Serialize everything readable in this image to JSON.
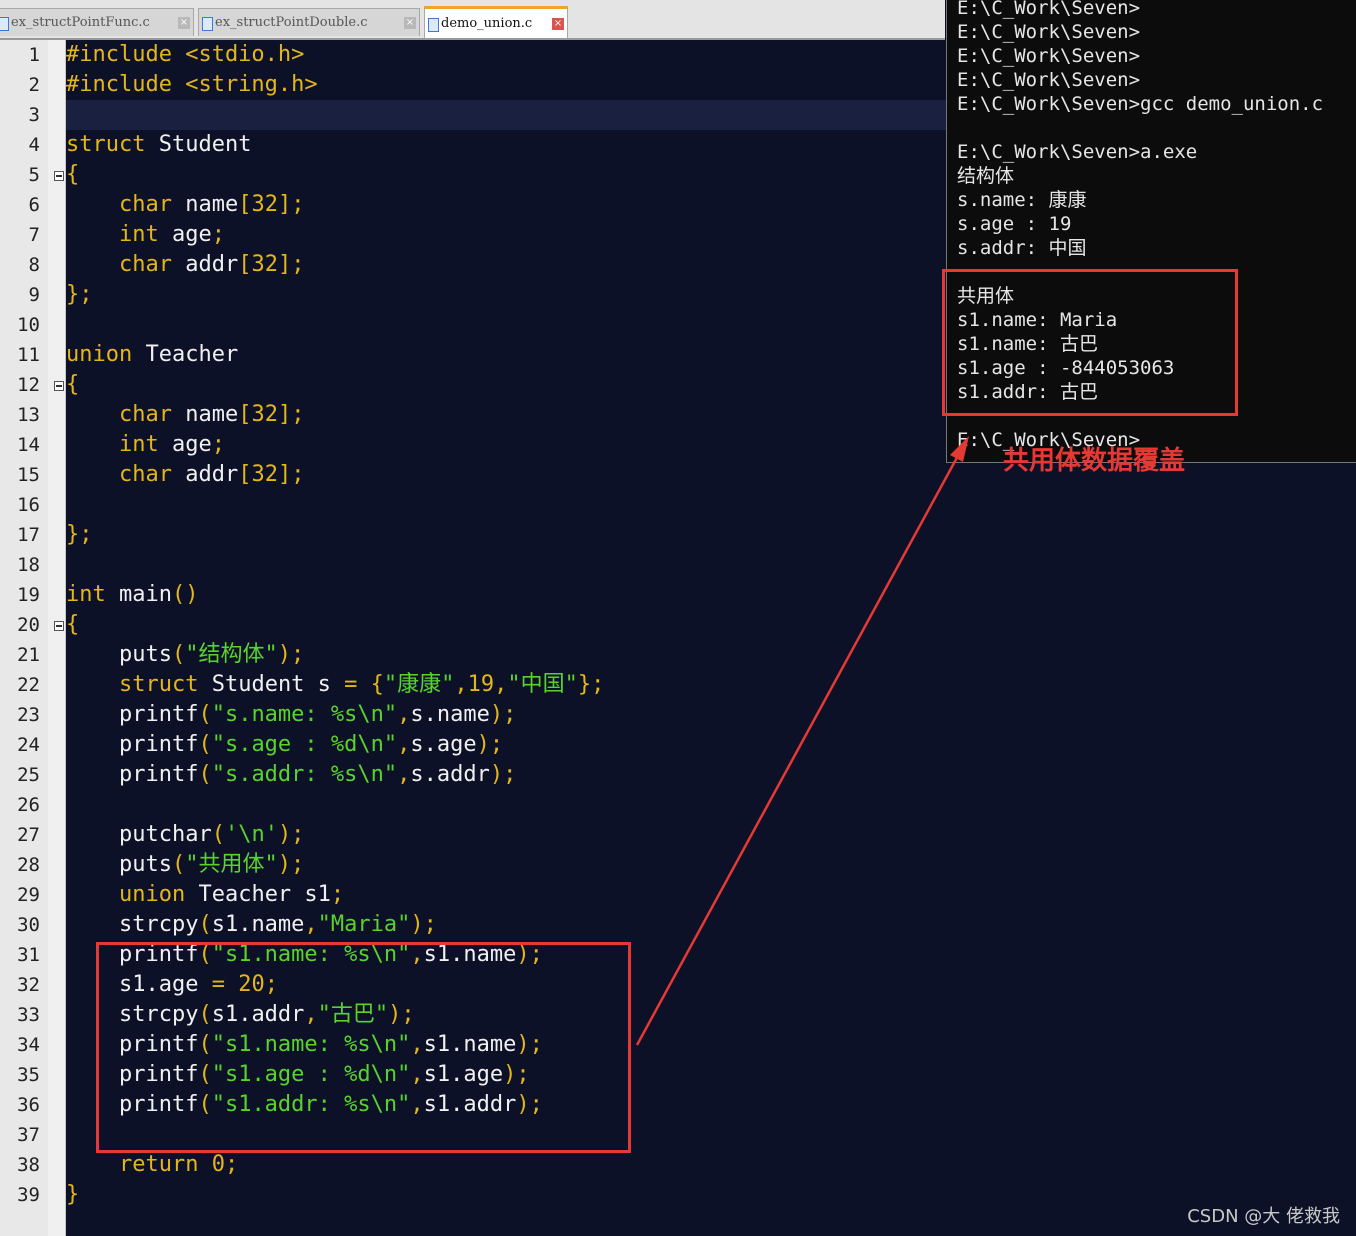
{
  "tabs": [
    {
      "label": "ex_structPointFunc.c",
      "close": "×"
    },
    {
      "label": "ex_structPointDouble.c",
      "close": "×"
    },
    {
      "label": "demo_union.c",
      "close": "×"
    }
  ],
  "code": [
    [
      [
        "pp",
        "#include <stdio.h>"
      ]
    ],
    [
      [
        "pp",
        "#include <string.h>"
      ]
    ],
    [],
    [
      [
        "kw",
        "struct"
      ],
      [
        "pl",
        " Student"
      ]
    ],
    [
      [
        "op",
        "{"
      ]
    ],
    [
      [
        "pl",
        "    "
      ],
      [
        "kw",
        "char"
      ],
      [
        "pl",
        " name"
      ],
      [
        "op",
        "["
      ],
      [
        "num",
        "32"
      ],
      [
        "op",
        "];"
      ]
    ],
    [
      [
        "pl",
        "    "
      ],
      [
        "kw",
        "int"
      ],
      [
        "pl",
        " age"
      ],
      [
        "op",
        ";"
      ]
    ],
    [
      [
        "pl",
        "    "
      ],
      [
        "kw",
        "char"
      ],
      [
        "pl",
        " addr"
      ],
      [
        "op",
        "["
      ],
      [
        "num",
        "32"
      ],
      [
        "op",
        "];"
      ]
    ],
    [
      [
        "op",
        "};"
      ]
    ],
    [],
    [
      [
        "kw",
        "union"
      ],
      [
        "pl",
        " Teacher"
      ]
    ],
    [
      [
        "op",
        "{"
      ]
    ],
    [
      [
        "pl",
        "    "
      ],
      [
        "kw",
        "char"
      ],
      [
        "pl",
        " name"
      ],
      [
        "op",
        "["
      ],
      [
        "num",
        "32"
      ],
      [
        "op",
        "];"
      ]
    ],
    [
      [
        "pl",
        "    "
      ],
      [
        "kw",
        "int"
      ],
      [
        "pl",
        " age"
      ],
      [
        "op",
        ";"
      ]
    ],
    [
      [
        "pl",
        "    "
      ],
      [
        "kw",
        "char"
      ],
      [
        "pl",
        " addr"
      ],
      [
        "op",
        "["
      ],
      [
        "num",
        "32"
      ],
      [
        "op",
        "];"
      ]
    ],
    [],
    [
      [
        "op",
        "};"
      ]
    ],
    [],
    [
      [
        "kw",
        "int"
      ],
      [
        "pl",
        " main"
      ],
      [
        "op",
        "()"
      ]
    ],
    [
      [
        "op",
        "{"
      ]
    ],
    [
      [
        "pl",
        "    puts"
      ],
      [
        "op",
        "("
      ],
      [
        "str",
        "\"结构体\""
      ],
      [
        "op",
        ");"
      ]
    ],
    [
      [
        "pl",
        "    "
      ],
      [
        "kw",
        "struct"
      ],
      [
        "pl",
        " Student s "
      ],
      [
        "op",
        "="
      ],
      [
        "pl",
        " "
      ],
      [
        "op",
        "{"
      ],
      [
        "str",
        "\"康康\""
      ],
      [
        "op",
        ","
      ],
      [
        "num",
        "19"
      ],
      [
        "op",
        ","
      ],
      [
        "str",
        "\"中国\""
      ],
      [
        "op",
        "};"
      ]
    ],
    [
      [
        "pl",
        "    printf"
      ],
      [
        "op",
        "("
      ],
      [
        "str",
        "\"s.name: %s\\n\""
      ],
      [
        "op",
        ","
      ],
      [
        "pl",
        "s.name"
      ],
      [
        "op",
        ");"
      ]
    ],
    [
      [
        "pl",
        "    printf"
      ],
      [
        "op",
        "("
      ],
      [
        "str",
        "\"s.age : %d\\n\""
      ],
      [
        "op",
        ","
      ],
      [
        "pl",
        "s.age"
      ],
      [
        "op",
        ");"
      ]
    ],
    [
      [
        "pl",
        "    printf"
      ],
      [
        "op",
        "("
      ],
      [
        "str",
        "\"s.addr: %s\\n\""
      ],
      [
        "op",
        ","
      ],
      [
        "pl",
        "s.addr"
      ],
      [
        "op",
        ");"
      ]
    ],
    [],
    [
      [
        "pl",
        "    putchar"
      ],
      [
        "op",
        "("
      ],
      [
        "str",
        "'\\n'"
      ],
      [
        "op",
        ");"
      ]
    ],
    [
      [
        "pl",
        "    puts"
      ],
      [
        "op",
        "("
      ],
      [
        "str",
        "\"共用体\""
      ],
      [
        "op",
        ");"
      ]
    ],
    [
      [
        "pl",
        "    "
      ],
      [
        "kw",
        "union"
      ],
      [
        "pl",
        " Teacher s1"
      ],
      [
        "op",
        ";"
      ]
    ],
    [
      [
        "pl",
        "    strcpy"
      ],
      [
        "op",
        "("
      ],
      [
        "pl",
        "s1.name"
      ],
      [
        "op",
        ","
      ],
      [
        "str",
        "\"Maria\""
      ],
      [
        "op",
        ");"
      ]
    ],
    [
      [
        "pl",
        "    printf"
      ],
      [
        "op",
        "("
      ],
      [
        "str",
        "\"s1.name: %s\\n\""
      ],
      [
        "op",
        ","
      ],
      [
        "pl",
        "s1.name"
      ],
      [
        "op",
        ");"
      ]
    ],
    [
      [
        "pl",
        "    s1.age "
      ],
      [
        "op",
        "="
      ],
      [
        "pl",
        " "
      ],
      [
        "num",
        "20"
      ],
      [
        "op",
        ";"
      ]
    ],
    [
      [
        "pl",
        "    strcpy"
      ],
      [
        "op",
        "("
      ],
      [
        "pl",
        "s1.addr"
      ],
      [
        "op",
        ","
      ],
      [
        "str",
        "\"古巴\""
      ],
      [
        "op",
        ");"
      ]
    ],
    [
      [
        "pl",
        "    printf"
      ],
      [
        "op",
        "("
      ],
      [
        "str",
        "\"s1.name: %s\\n\""
      ],
      [
        "op",
        ","
      ],
      [
        "pl",
        "s1.name"
      ],
      [
        "op",
        ");"
      ]
    ],
    [
      [
        "pl",
        "    printf"
      ],
      [
        "op",
        "("
      ],
      [
        "str",
        "\"s1.age : %d\\n\""
      ],
      [
        "op",
        ","
      ],
      [
        "pl",
        "s1.age"
      ],
      [
        "op",
        ");"
      ]
    ],
    [
      [
        "pl",
        "    printf"
      ],
      [
        "op",
        "("
      ],
      [
        "str",
        "\"s1.addr: %s\\n\""
      ],
      [
        "op",
        ","
      ],
      [
        "pl",
        "s1.addr"
      ],
      [
        "op",
        ");"
      ]
    ],
    [],
    [
      [
        "pl",
        "    "
      ],
      [
        "kw",
        "return"
      ],
      [
        "pl",
        " "
      ],
      [
        "num",
        "0"
      ],
      [
        "op",
        ";"
      ]
    ],
    [
      [
        "op",
        "}"
      ]
    ]
  ],
  "fold_lines": [
    5,
    12,
    20
  ],
  "console": {
    "lines": [
      "E:\\C_Work\\Seven>",
      "E:\\C_Work\\Seven>",
      "E:\\C_Work\\Seven>",
      "E:\\C_Work\\Seven>",
      "E:\\C_Work\\Seven>gcc demo_union.c",
      "",
      "E:\\C_Work\\Seven>a.exe",
      "结构体",
      "s.name: 康康",
      "s.age : 19",
      "s.addr: 中国",
      "",
      "共用体",
      "s1.name: Maria",
      "s1.name: 古巴",
      "s1.age : -844053063",
      "s1.addr: 古巴",
      "",
      "E:\\C_Work\\Seven>"
    ]
  },
  "annotation": {
    "text": "共用体数据覆盖"
  },
  "watermark": "CSDN @大 佬救我",
  "colors": {
    "accent_red": "#e53935",
    "keyword": "#e3b71a",
    "string": "#58d32c",
    "background": "#0d1127"
  }
}
